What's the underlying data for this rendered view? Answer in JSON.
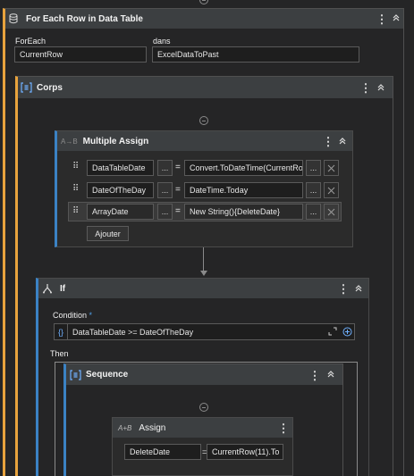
{
  "foreach": {
    "title": "For Each Row in Data Table",
    "foreach_label": "ForEach",
    "foreach_value": "CurrentRow",
    "dans_label": "dans",
    "dans_value": "ExcelDataToPast"
  },
  "corps": {
    "title": "Corps"
  },
  "multiple_assign": {
    "title": "Multiple Assign",
    "rows": [
      {
        "target": "DataTableDate",
        "value": "Convert.ToDateTime(CurrentRo"
      },
      {
        "target": "DateOfTheDay",
        "value": "DateTime.Today"
      },
      {
        "target": "ArrayDate",
        "value": "New String(){DeleteDate}"
      }
    ],
    "dots": "...",
    "equals": "=",
    "add_label": "Ajouter"
  },
  "if_block": {
    "title": "If",
    "condition_label": "Condition",
    "required_mark": "*",
    "condition_value": "DataTableDate >= DateOfTheDay",
    "then_label": "Then"
  },
  "sequence": {
    "title": "Sequence"
  },
  "assign": {
    "title": "Assign",
    "target": "DeleteDate",
    "equals": "=",
    "value": "CurrentRow(11).To"
  },
  "colors": {
    "background": "#252526",
    "header": "#3c3f41",
    "accent_orange": "#e8a33d",
    "accent_blue": "#3b82c4",
    "field_bg": "#1e1e1e"
  }
}
